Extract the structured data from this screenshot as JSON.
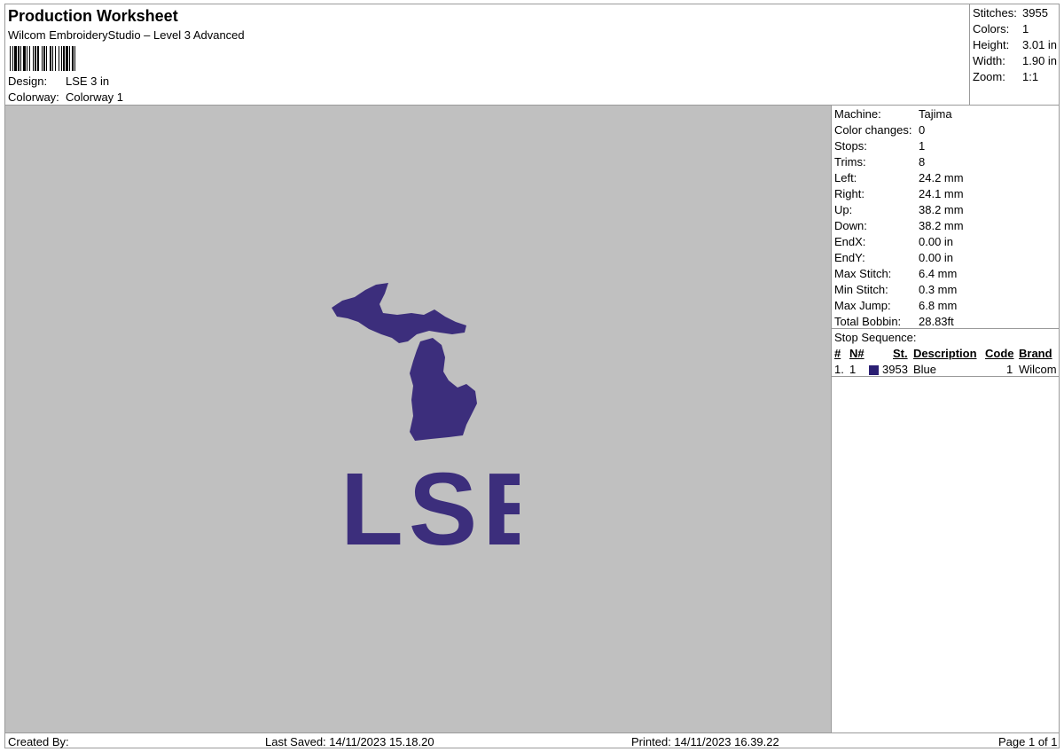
{
  "header": {
    "title": "Production Worksheet",
    "subtitle": "Wilcom EmbroideryStudio – Level 3 Advanced",
    "design_label": "Design:",
    "design_value": "LSE 3 in",
    "colorway_label": "Colorway:",
    "colorway_value": "Colorway 1"
  },
  "stats": [
    {
      "label": "Stitches:",
      "value": "3955"
    },
    {
      "label": "Colors:",
      "value": "1"
    },
    {
      "label": "Height:",
      "value": "3.01 in"
    },
    {
      "label": "Width:",
      "value": "1.90 in"
    },
    {
      "label": "Zoom:",
      "value": "1:1"
    }
  ],
  "properties": [
    {
      "label": "Machine:",
      "value": "Tajima"
    },
    {
      "label": "Color changes:",
      "value": "0"
    },
    {
      "label": "Stops:",
      "value": "1"
    },
    {
      "label": "Trims:",
      "value": "8"
    },
    {
      "label": "Left:",
      "value": "24.2 mm"
    },
    {
      "label": "Right:",
      "value": "24.1 mm"
    },
    {
      "label": "Up:",
      "value": "38.2 mm"
    },
    {
      "label": "Down:",
      "value": "38.2 mm"
    },
    {
      "label": "EndX:",
      "value": "0.00 in"
    },
    {
      "label": "EndY:",
      "value": "0.00 in"
    },
    {
      "label": "Max Stitch:",
      "value": "6.4 mm"
    },
    {
      "label": "Min Stitch:",
      "value": "0.3 mm"
    },
    {
      "label": "Max Jump:",
      "value": "6.8 mm"
    },
    {
      "label": "Total Bobbin:",
      "value": "28.83ft"
    }
  ],
  "stop_sequence": {
    "title": "Stop Sequence:",
    "headers": {
      "num": "#",
      "n": "N#",
      "st": "St.",
      "description": "Description",
      "code": "Code",
      "brand": "Brand"
    },
    "rows": [
      {
        "num": "1.",
        "n": "1",
        "st": "3953",
        "description": "Blue",
        "code": "1",
        "brand": "Wilcom",
        "color": "#2b1f73"
      }
    ]
  },
  "design_preview": {
    "text": "LSE",
    "thread_color": "#3c2e7c"
  },
  "footer": {
    "created_by": "Created By:",
    "last_saved": "Last Saved: 14/11/2023 15.18.20",
    "printed": "Printed: 14/11/2023 16.39.22",
    "page": "Page 1 of 1"
  }
}
